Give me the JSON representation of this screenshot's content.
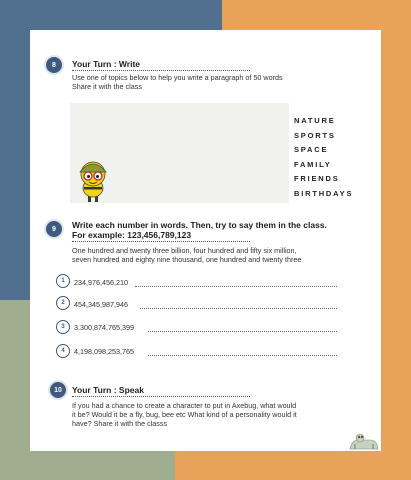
{
  "section8": {
    "number": "8",
    "title": "Your Turn : Write",
    "instructions": [
      "Use one of topics below to help you write a paragraph of 50 words",
      "Share it with the class"
    ],
    "topics": [
      "NATURE",
      "SPORTS",
      "SPACE",
      "FAMILY",
      "FRIENDS",
      "BIRTHDAYS"
    ]
  },
  "section9": {
    "number": "9",
    "title": "Write each number in words. Then, try to say them in the class.",
    "example_label": "For example: 123,456,789,123",
    "example_answer": [
      "One hundred and twenty three billion, four hundred and fifty six million,",
      "seven hundred and eighty nine thousand, one hundred and twenty three"
    ],
    "exercises": [
      {
        "n": "1",
        "value": "234,976,456,210"
      },
      {
        "n": "2",
        "value": "454,345,987,946"
      },
      {
        "n": "3",
        "value": "3.300,874,765,399"
      },
      {
        "n": "4",
        "value": "4,198,098,253,765"
      }
    ]
  },
  "section10": {
    "number": "10",
    "title": "Your Turn : Speak",
    "text": [
      "If you had a chance to create a character to put in Axebug, what would",
      "it be? Would it be a fly, bug, bee etc  What kind of a personality would it",
      "have? Share it with the classs"
    ]
  },
  "icons": {
    "mascot": "cartoon-bug-mascot-icon",
    "footer_decoration": "bug-creature-icon"
  },
  "colors": {
    "accent": "#3f5a7e",
    "bg_blue": "#51708f",
    "bg_orange": "#e8a25a",
    "bg_green": "#9eae8f"
  }
}
